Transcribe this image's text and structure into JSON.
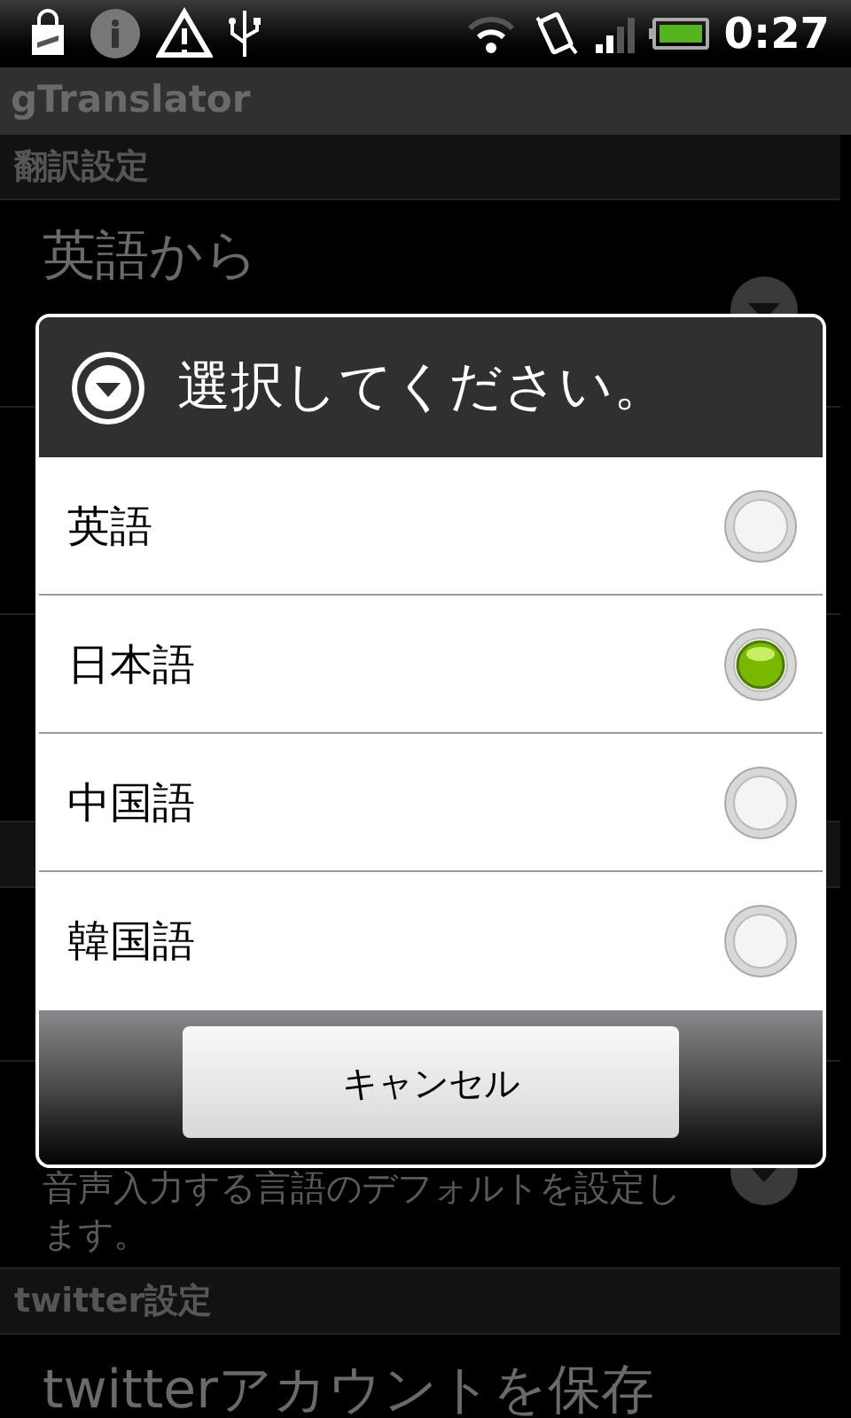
{
  "status_bar": {
    "time": "0:27"
  },
  "app_bar": {
    "title": "gTranslator"
  },
  "preferences": [
    {
      "kind": "header",
      "title": "翻訳設定"
    },
    {
      "kind": "two_line",
      "title": "英語から",
      "dropdown": true
    },
    {
      "kind": "two_line"
    },
    {
      "kind": "two_line"
    },
    {
      "kind": "header"
    },
    {
      "kind": "one_line"
    },
    {
      "kind": "two_line",
      "summary": "音声入力する言語のデフォルトを設定します。",
      "dropdown": true
    },
    {
      "kind": "header",
      "title": "twitter設定"
    },
    {
      "kind": "two_line",
      "title": "twitterアカウントを保存"
    }
  ],
  "dialog": {
    "title": "選択してください。",
    "options": [
      {
        "label": "英語",
        "selected": false
      },
      {
        "label": "日本語",
        "selected": true
      },
      {
        "label": "中国語",
        "selected": false
      },
      {
        "label": "韓国語",
        "selected": false
      }
    ],
    "cancel_button": "キャンセル"
  }
}
